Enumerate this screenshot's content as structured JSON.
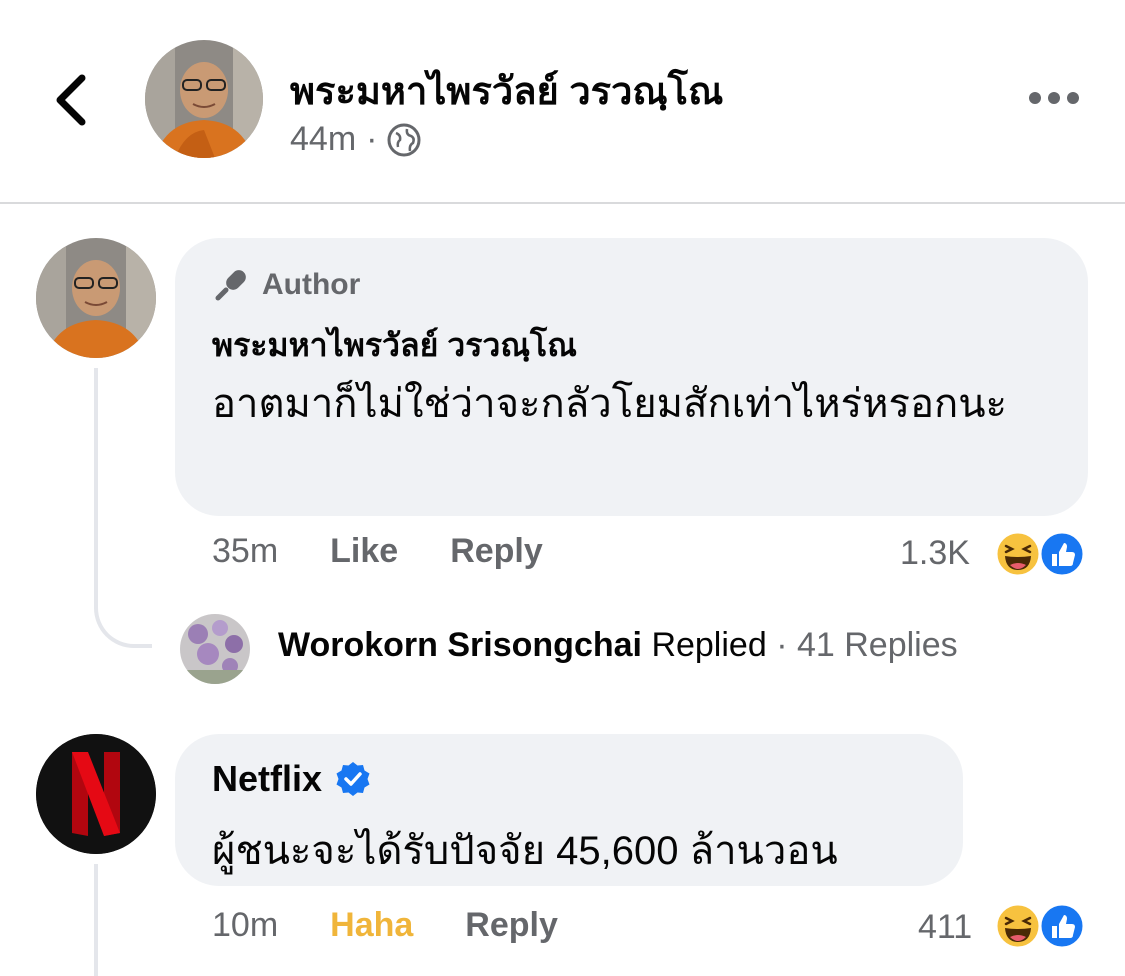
{
  "header": {
    "name": "พระมหาไพรวัลย์ วรวณฺโณ",
    "time": "44m",
    "separator": "·",
    "privacy_icon": "globe-icon"
  },
  "comments": [
    {
      "badge": "Author",
      "name": "พระมหาไพรวัลย์ วรวณฺโณ",
      "text": "อาตมาก็ไม่ใช่ว่าจะกลัวโยมสักเท่าไหร่หรอกนะ",
      "time": "35m",
      "like_label": "Like",
      "reply_label": "Reply",
      "reaction_count": "1.3K",
      "reactions": [
        "haha-icon",
        "like-icon"
      ]
    },
    {
      "name": "Netflix",
      "verified": true,
      "text": "ผู้ชนะจะได้รับปัจจัย 45,600 ล้านวอน",
      "time": "10m",
      "like_label": "Haha",
      "reply_label": "Reply",
      "reaction_count": "411",
      "reactions": [
        "haha-icon",
        "like-icon"
      ]
    }
  ],
  "replied": {
    "name": "Worokorn Srisongchai",
    "action": "Replied",
    "separator": "·",
    "count_text": "41 Replies"
  },
  "colors": {
    "bubble": "#f0f2f5",
    "secondary_text": "#65676b",
    "haha_active": "#f0b53a",
    "like_blue": "#1877f2",
    "netflix_red": "#e50914"
  }
}
